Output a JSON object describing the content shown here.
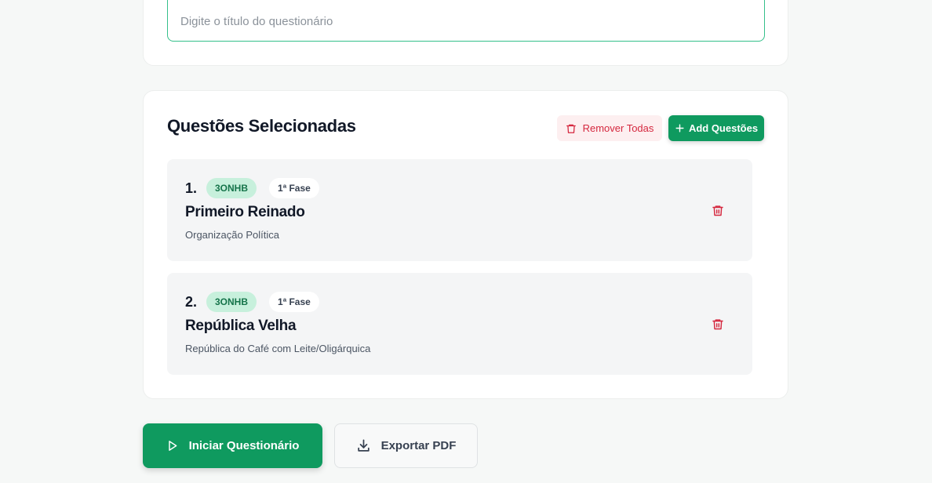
{
  "title_card": {
    "input_value": "",
    "input_placeholder": "Digite o título do questionário"
  },
  "questions_section": {
    "title": "Questões Selecionadas",
    "remove_all_label": "Remover Todas",
    "add_label": "Add Questões",
    "items": [
      {
        "number": "1.",
        "source": "3ONHB",
        "phase": "1ª Fase",
        "topic": "Primeiro Reinado",
        "subtopic": "Organização Política"
      },
      {
        "number": "2.",
        "source": "3ONHB",
        "phase": "1ª Fase",
        "topic": "República Velha",
        "subtopic": "República do Café com Leite/Oligárquica"
      }
    ]
  },
  "actions": {
    "start_label": "Iniciar Questionário",
    "export_label": "Exportar PDF"
  },
  "icons": {
    "remove_all": "trash-icon",
    "add": "plus-icon",
    "item_delete": "trash-icon",
    "start": "play-icon",
    "export": "download-icon"
  },
  "colors": {
    "primary": "#0f9a5f",
    "danger": "#d5283f",
    "danger_bg": "#fdeff0",
    "badge_source_bg": "#c7f0dc",
    "input_border": "#34c08a"
  }
}
